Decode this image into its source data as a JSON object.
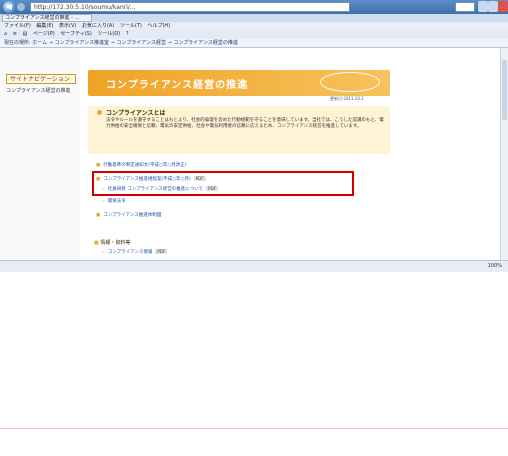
{
  "window": {
    "url": "http://172.30.5.10/soumu/kanri/...",
    "tab_label": "コンプライアンス経営の推進 - ..."
  },
  "menu": [
    "ファイル(F)",
    "編集(E)",
    "表示(V)",
    "お気に入り(A)",
    "ツール(T)",
    "ヘルプ(H)"
  ],
  "commands": [
    "ページ(P)",
    "セーフティ(S)",
    "ツール(O)"
  ],
  "breadcrumb": "現在の場所: ホーム → コンプライアンス推進室 → コンプライアンス経営 → コンプライアンス経営の推進",
  "left_nav": {
    "section": "サイトナビゲーション",
    "item": "コンプライアンス経営の推進"
  },
  "banner": {
    "title": "コンプライアンス経営の推進",
    "updated": "更新日:2011.10.1"
  },
  "topic": {
    "title": "コンプライアンスとは",
    "text": "法令やルールを遵守することはもとより、社会的倫理を含めた行動規範を守ることを意味しています。当社では、こうした認識のもと、電力供給の安全確保と信頼、電気の安定供給、社会や電気利用者の信頼に応えるため、コンプライアンス経営を推進しています。"
  },
  "links": [
    {
      "text": "行動基準の制定通知文(平成○年○月改正)"
    },
    {
      "text": "コンプライアンス推進規程案(平成○年○月)",
      "badge": "PDF"
    },
    {
      "text": "社員研修 コンプライアンス経営の推進について",
      "badge": "PDF"
    },
    {
      "text": "関係法令"
    },
    {
      "text": "コンプライアンス推進体制図"
    }
  ],
  "sub_section": {
    "title": "情報・資料等",
    "link": "コンプライアンス情報",
    "badge": "PDF"
  },
  "status": {
    "zoom": "100%"
  }
}
